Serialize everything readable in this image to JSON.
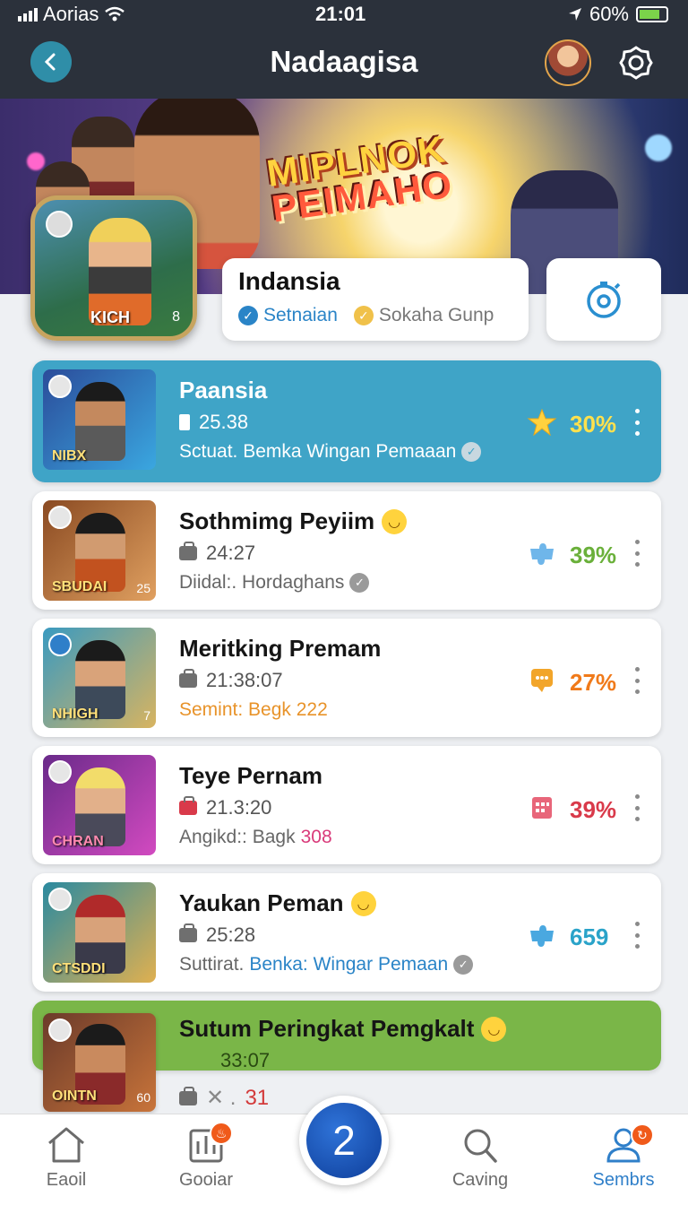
{
  "status_bar": {
    "carrier": "Aorias",
    "time": "21:01",
    "battery": "60%"
  },
  "header": {
    "title": "Nadaagisa"
  },
  "banner": {
    "title_line1": "MIPLNOK",
    "title_line2": "PEIMAHO"
  },
  "profile": {
    "badge_tag": "KICH",
    "badge_num": "8",
    "name": "Indansia",
    "meta_primary": "Setnaian",
    "meta_secondary": "Sokaha Gunp"
  },
  "list": [
    {
      "title": "Paansia",
      "time": "25.38",
      "subtitle": "Sctuat. Bemka Wingan Pemaaan",
      "percent": "30%",
      "thumb_caption": "NIBX",
      "thumb_num": "",
      "icon": "star-icon",
      "percent_color": "#ffe14d",
      "active": true
    },
    {
      "title": "Sothmimg Peyiim",
      "time": "24:27",
      "subtitle": "Diidal:. Hordaghans",
      "percent": "39%",
      "thumb_caption": "SBUDAI",
      "thumb_num": "25",
      "icon": "puzzle-icon",
      "percent_color": "#6ab03a"
    },
    {
      "title": "Meritking Premam",
      "time": "21:38:07",
      "subtitle": "Semint: Begk 222",
      "percent": "27%",
      "thumb_caption": "NHIGH",
      "thumb_num": "7",
      "icon": "chat-icon",
      "percent_color": "#f07a1a"
    },
    {
      "title": "Teye Pernam",
      "time": "21.3:20",
      "subtitle_prefix": "Angikd:: Bagk",
      "subtitle_value": "308",
      "percent": "39%",
      "thumb_caption": "CHRAN",
      "thumb_num": "",
      "icon": "calendar-icon",
      "percent_color": "#d93a4a"
    },
    {
      "title": "Yaukan Peman",
      "time": "25:28",
      "subtitle_prefix": "Suttirat.",
      "subtitle_value": "Benka: Wingar Pemaan",
      "percent": "659",
      "thumb_caption": "CTSDDI",
      "thumb_num": "",
      "icon": "puzzle-icon",
      "percent_color": "#2aa3c9"
    },
    {
      "title": "Sutum Peringkat Pemgkalt",
      "time": "33:07",
      "subtitle": "31",
      "thumb_caption": "OINTN",
      "thumb_num": "60"
    }
  ],
  "nav": {
    "items": [
      {
        "label": "Eaoil",
        "icon": "home-icon"
      },
      {
        "label": "Gooiar",
        "icon": "stats-icon",
        "badge": ""
      },
      {
        "label": "2",
        "icon": "fab"
      },
      {
        "label": "Caving",
        "icon": "search-icon"
      },
      {
        "label": "Sembrs",
        "icon": "profile-icon",
        "badge": ""
      }
    ]
  },
  "colors": {
    "accent": "#3fa4c7",
    "header_bg": "#2b313b",
    "highlight": "#7ab648",
    "nav_active": "#2f7fc9"
  }
}
